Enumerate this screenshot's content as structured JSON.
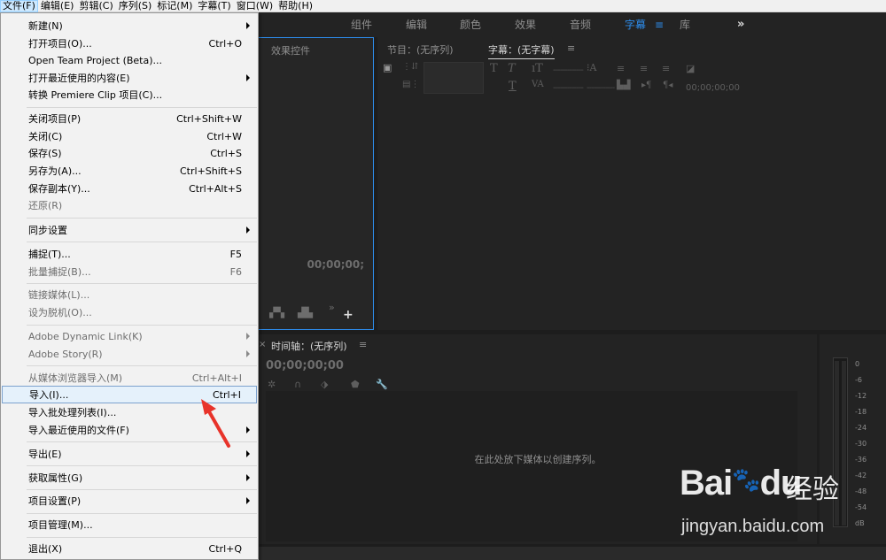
{
  "menubar": [
    "文件(F)",
    "编辑(E)",
    "剪辑(C)",
    "序列(S)",
    "标记(M)",
    "字幕(T)",
    "窗口(W)",
    "帮助(H)"
  ],
  "workspaces": {
    "tabs": [
      "组件",
      "编辑",
      "颜色",
      "效果",
      "音频",
      "字幕",
      "库"
    ],
    "active": "字幕",
    "menu_glyph": "≡",
    "more_glyph": "»"
  },
  "effects_panel": {
    "tab": "效果控件",
    "timecode": "00;00;00;"
  },
  "right_panel": {
    "tab_program": "节目：(无序列)",
    "tab_caption": "字幕：(无字幕)",
    "menu_glyph": "≡",
    "timecode": "00;00;00;00"
  },
  "timeline": {
    "close_glyph": "×",
    "tab": "时间轴：(无序列)",
    "menu_glyph": "≡",
    "timecode": "00;00;00;00",
    "empty_message": "在此处放下媒体以创建序列。"
  },
  "audio_meter": {
    "scale": [
      "0",
      "-6",
      "-12",
      "-18",
      "-24",
      "-30",
      "-36",
      "-42",
      "-48",
      "-54",
      "dB"
    ]
  },
  "file_menu": {
    "items": [
      {
        "label": "新建(N)",
        "shortcut": "",
        "submenu": true,
        "disabled": false
      },
      {
        "label": "打开项目(O)...",
        "shortcut": "Ctrl+O",
        "submenu": false,
        "disabled": false
      },
      {
        "label": "Open Team Project (Beta)...",
        "shortcut": "",
        "submenu": false,
        "disabled": false
      },
      {
        "label": "打开最近使用的内容(E)",
        "shortcut": "",
        "submenu": true,
        "disabled": false
      },
      {
        "label": "转换 Premiere Clip 项目(C)...",
        "shortcut": "",
        "submenu": false,
        "disabled": false
      },
      {
        "label": "关闭项目(P)",
        "shortcut": "Ctrl+Shift+W",
        "submenu": false,
        "disabled": false
      },
      {
        "label": "关闭(C)",
        "shortcut": "Ctrl+W",
        "submenu": false,
        "disabled": false
      },
      {
        "label": "保存(S)",
        "shortcut": "Ctrl+S",
        "submenu": false,
        "disabled": false
      },
      {
        "label": "另存为(A)...",
        "shortcut": "Ctrl+Shift+S",
        "submenu": false,
        "disabled": false
      },
      {
        "label": "保存副本(Y)...",
        "shortcut": "Ctrl+Alt+S",
        "submenu": false,
        "disabled": false
      },
      {
        "label": "还原(R)",
        "shortcut": "",
        "submenu": false,
        "disabled": true
      },
      {
        "label": "同步设置",
        "shortcut": "",
        "submenu": true,
        "disabled": false
      },
      {
        "label": "捕捉(T)...",
        "shortcut": "F5",
        "submenu": false,
        "disabled": false
      },
      {
        "label": "批量捕捉(B)...",
        "shortcut": "F6",
        "submenu": false,
        "disabled": true
      },
      {
        "label": "链接媒体(L)...",
        "shortcut": "",
        "submenu": false,
        "disabled": true
      },
      {
        "label": "设为脱机(O)...",
        "shortcut": "",
        "submenu": false,
        "disabled": true
      },
      {
        "label": "Adobe Dynamic Link(K)",
        "shortcut": "",
        "submenu": true,
        "disabled": true
      },
      {
        "label": "Adobe Story(R)",
        "shortcut": "",
        "submenu": true,
        "disabled": true
      },
      {
        "label": "从媒体浏览器导入(M)",
        "shortcut": "Ctrl+Alt+I",
        "submenu": false,
        "disabled": true
      },
      {
        "label": "导入(I)...",
        "shortcut": "Ctrl+I",
        "submenu": false,
        "disabled": false,
        "highlighted": true
      },
      {
        "label": "导入批处理列表(I)...",
        "shortcut": "",
        "submenu": false,
        "disabled": false
      },
      {
        "label": "导入最近使用的文件(F)",
        "shortcut": "",
        "submenu": true,
        "disabled": false
      },
      {
        "label": "导出(E)",
        "shortcut": "",
        "submenu": true,
        "disabled": false
      },
      {
        "label": "获取属性(G)",
        "shortcut": "",
        "submenu": true,
        "disabled": false
      },
      {
        "label": "项目设置(P)",
        "shortcut": "",
        "submenu": true,
        "disabled": false
      },
      {
        "label": "项目管理(M)...",
        "shortcut": "",
        "submenu": false,
        "disabled": false
      },
      {
        "label": "退出(X)",
        "shortcut": "Ctrl+Q",
        "submenu": false,
        "disabled": false
      }
    ]
  },
  "watermark": {
    "brand": "Bai",
    "brand_suffix": "du",
    "cn": "经验",
    "url": "jingyan.baidu.com"
  },
  "colors": {
    "accent": "#2d8ceb",
    "annotation": "#e8332a",
    "menu_bg": "#f2f2f2",
    "app_bg": "#1d1d1d"
  }
}
